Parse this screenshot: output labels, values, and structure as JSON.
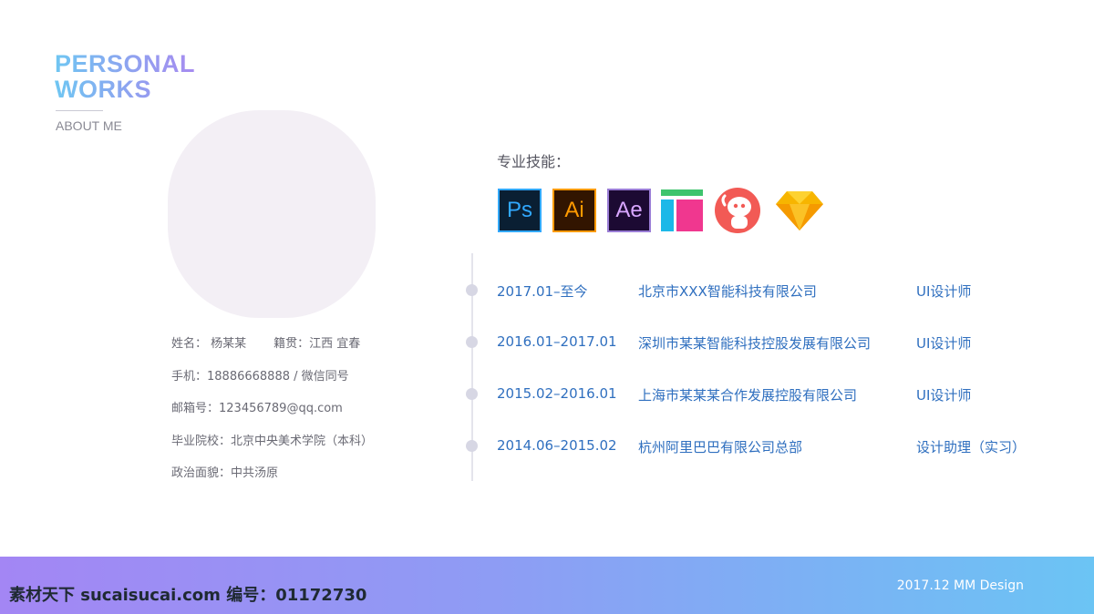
{
  "header": {
    "title_line1": "PERSONAL",
    "title_line2": "WORKS",
    "subtitle": "ABOUT ME"
  },
  "profile": {
    "name": "姓名： 杨某某",
    "hometown": "籍贯：江西  宜春",
    "phone": "手机：18886668888 / 微信同号",
    "email": "邮箱号：123456789@qq.com",
    "school": "毕业院校：北京中央美术学院（本科）",
    "politics": "政治面貌：中共汤原"
  },
  "skills": {
    "label": "专业技能：",
    "icons": [
      {
        "name": "photoshop-icon",
        "text": "Ps",
        "bg": "#0a1f33",
        "fg": "#31a8ff",
        "border": "#31a8ff"
      },
      {
        "name": "illustrator-icon",
        "text": "Ai",
        "bg": "#321500",
        "fg": "#ff9a00",
        "border": "#ff9a00"
      },
      {
        "name": "after-effects-icon",
        "text": "Ae",
        "bg": "#1c0a33",
        "fg": "#d8a6ff",
        "border": "#9a7dd6"
      },
      {
        "name": "axure-icon",
        "text": "",
        "bg": "",
        "fg": "",
        "border": ""
      },
      {
        "name": "mascot-app-icon",
        "text": "",
        "bg": "#f25a55",
        "fg": "#ffffff",
        "border": ""
      },
      {
        "name": "sketch-icon",
        "text": "",
        "bg": "",
        "fg": "#f7b500",
        "border": ""
      }
    ]
  },
  "timeline": [
    {
      "period": "2017.01–至今",
      "company": "北京市XXX智能科技有限公司",
      "role": "UI设计师"
    },
    {
      "period": "2016.01–2017.01",
      "company": "深圳市某某智能科技控股发展有限公司",
      "role": "UI设计师"
    },
    {
      "period": "2015.02–2016.01",
      "company": "上海市某某某合作发展控股有限公司",
      "role": "UI设计师"
    },
    {
      "period": "2014.06–2015.02",
      "company": "杭州阿里巴巴有限公司总部",
      "role": "设计助理（实习）"
    }
  ],
  "footer": {
    "credit": "2017.12  MM Design",
    "watermark": "素材天下 sucaisucai.com  编号：01172730"
  },
  "colors": {
    "accent_blue": "#2f6fbf",
    "gradient_start": "#a386f4",
    "gradient_end": "#6bc4f4"
  }
}
